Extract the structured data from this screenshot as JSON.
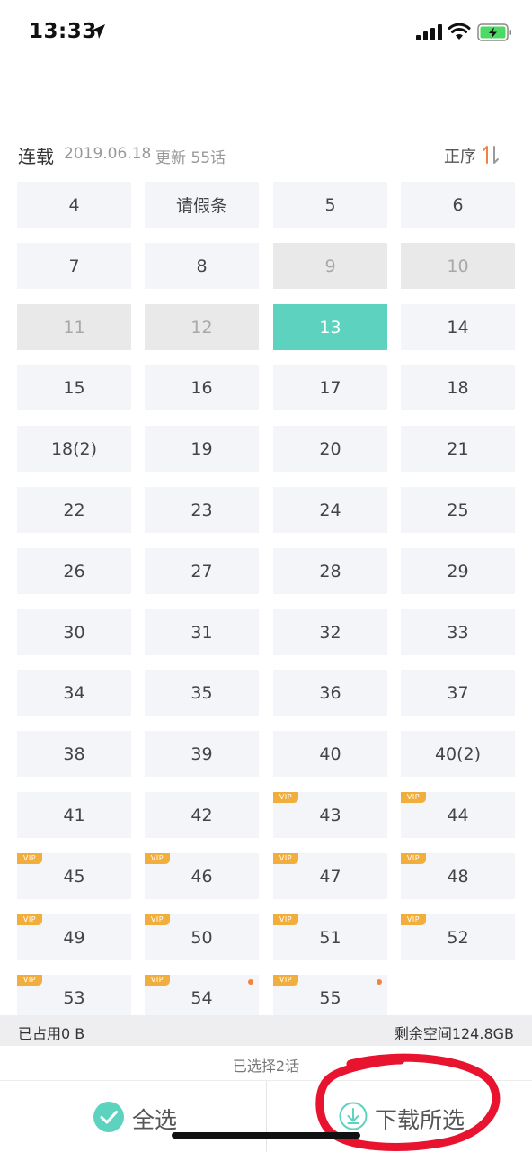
{
  "status_bar": {
    "time": "13:33",
    "icons": [
      "location-arrow-icon",
      "cellular-signal-icon",
      "wifi-icon",
      "battery-charging-icon"
    ],
    "battery_color": "#4cd964"
  },
  "series": {
    "label": "连载",
    "date": "2019.06.18",
    "updated": "更新 55话",
    "sort_label": "正序",
    "sort_icon": "sort-arrows-icon",
    "sort_icon_color": "#f2823d"
  },
  "episodes": [
    {
      "label": "4",
      "state": "normal"
    },
    {
      "label": "请假条",
      "state": "normal"
    },
    {
      "label": "5",
      "state": "normal"
    },
    {
      "label": "6",
      "state": "normal"
    },
    {
      "label": "7",
      "state": "normal"
    },
    {
      "label": "8",
      "state": "normal"
    },
    {
      "label": "9",
      "state": "downloaded"
    },
    {
      "label": "10",
      "state": "downloaded"
    },
    {
      "label": "11",
      "state": "downloaded"
    },
    {
      "label": "12",
      "state": "downloaded"
    },
    {
      "label": "13",
      "state": "selected"
    },
    {
      "label": "14",
      "state": "normal"
    },
    {
      "label": "15",
      "state": "normal"
    },
    {
      "label": "16",
      "state": "normal"
    },
    {
      "label": "17",
      "state": "normal"
    },
    {
      "label": "18",
      "state": "normal"
    },
    {
      "label": "18(2)",
      "state": "normal"
    },
    {
      "label": "19",
      "state": "normal"
    },
    {
      "label": "20",
      "state": "normal"
    },
    {
      "label": "21",
      "state": "normal"
    },
    {
      "label": "22",
      "state": "normal"
    },
    {
      "label": "23",
      "state": "normal"
    },
    {
      "label": "24",
      "state": "normal"
    },
    {
      "label": "25",
      "state": "normal"
    },
    {
      "label": "26",
      "state": "normal"
    },
    {
      "label": "27",
      "state": "normal"
    },
    {
      "label": "28",
      "state": "normal"
    },
    {
      "label": "29",
      "state": "normal"
    },
    {
      "label": "30",
      "state": "normal"
    },
    {
      "label": "31",
      "state": "normal"
    },
    {
      "label": "32",
      "state": "normal"
    },
    {
      "label": "33",
      "state": "normal"
    },
    {
      "label": "34",
      "state": "normal"
    },
    {
      "label": "35",
      "state": "normal"
    },
    {
      "label": "36",
      "state": "normal"
    },
    {
      "label": "37",
      "state": "normal"
    },
    {
      "label": "38",
      "state": "normal"
    },
    {
      "label": "39",
      "state": "normal"
    },
    {
      "label": "40",
      "state": "normal"
    },
    {
      "label": "40(2)",
      "state": "normal"
    },
    {
      "label": "41",
      "state": "normal"
    },
    {
      "label": "42",
      "state": "normal"
    },
    {
      "label": "43",
      "state": "normal",
      "vip": true
    },
    {
      "label": "44",
      "state": "normal",
      "vip": true
    },
    {
      "label": "45",
      "state": "normal",
      "vip": true
    },
    {
      "label": "46",
      "state": "normal",
      "vip": true
    },
    {
      "label": "47",
      "state": "normal",
      "vip": true
    },
    {
      "label": "48",
      "state": "normal",
      "vip": true
    },
    {
      "label": "49",
      "state": "normal",
      "vip": true
    },
    {
      "label": "50",
      "state": "normal",
      "vip": true
    },
    {
      "label": "51",
      "state": "normal",
      "vip": true
    },
    {
      "label": "52",
      "state": "normal",
      "vip": true
    },
    {
      "label": "53",
      "state": "normal",
      "vip": true
    },
    {
      "label": "54",
      "state": "normal",
      "vip": true,
      "new": true
    },
    {
      "label": "55",
      "state": "normal",
      "vip": true,
      "new": true
    }
  ],
  "vip_label": "VIP",
  "colors": {
    "selected": "#5dd3bf",
    "vip_badge": "#f2ae3d",
    "new_dot": "#f2823d",
    "annotation": "#e8132f"
  },
  "storage": {
    "used": "已占用0 B",
    "free": "剩余空间124.8GB"
  },
  "selection": {
    "count_text": "已选择2话"
  },
  "actions": {
    "select_all_label": "全选",
    "select_all_icon": "check-circle-icon",
    "download_label": "下载所选",
    "download_icon": "download-circle-icon"
  }
}
